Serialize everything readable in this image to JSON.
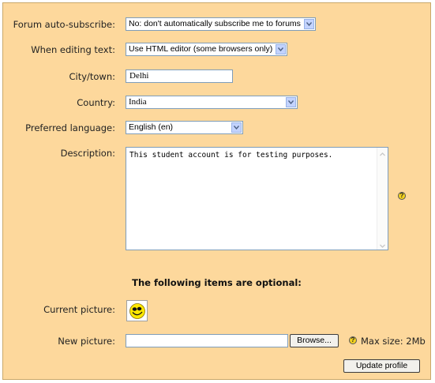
{
  "form": {
    "forum_autosubscribe": {
      "label": "Forum auto-subscribe:",
      "value": "No: don't automatically subscribe me to forums"
    },
    "editing_text": {
      "label": "When editing text:",
      "value": "Use HTML editor (some browsers only)"
    },
    "city": {
      "label": "City/town:",
      "value": "Delhi"
    },
    "country": {
      "label": "Country:",
      "value": "India"
    },
    "language": {
      "label": "Preferred language:",
      "value": "English (en)"
    },
    "description": {
      "label": "Description:",
      "value": "This student account is for testing purposes."
    },
    "optional_heading": "The following items are optional:",
    "current_picture": {
      "label": "Current picture:"
    },
    "new_picture": {
      "label": "New picture:",
      "value": "",
      "browse_label": "Browse...",
      "max_size": "Max size: 2Mb"
    },
    "submit_label": "Update profile"
  },
  "icons": {
    "help": "help-icon",
    "avatar": "smiley-face-icon",
    "dropdown": "chevron-down-icon"
  },
  "help_glyph": "?",
  "colors": {
    "panel_bg": "#fdd89c",
    "field_border": "#7f9db9",
    "dropdown_button": "#c3d3fd"
  }
}
